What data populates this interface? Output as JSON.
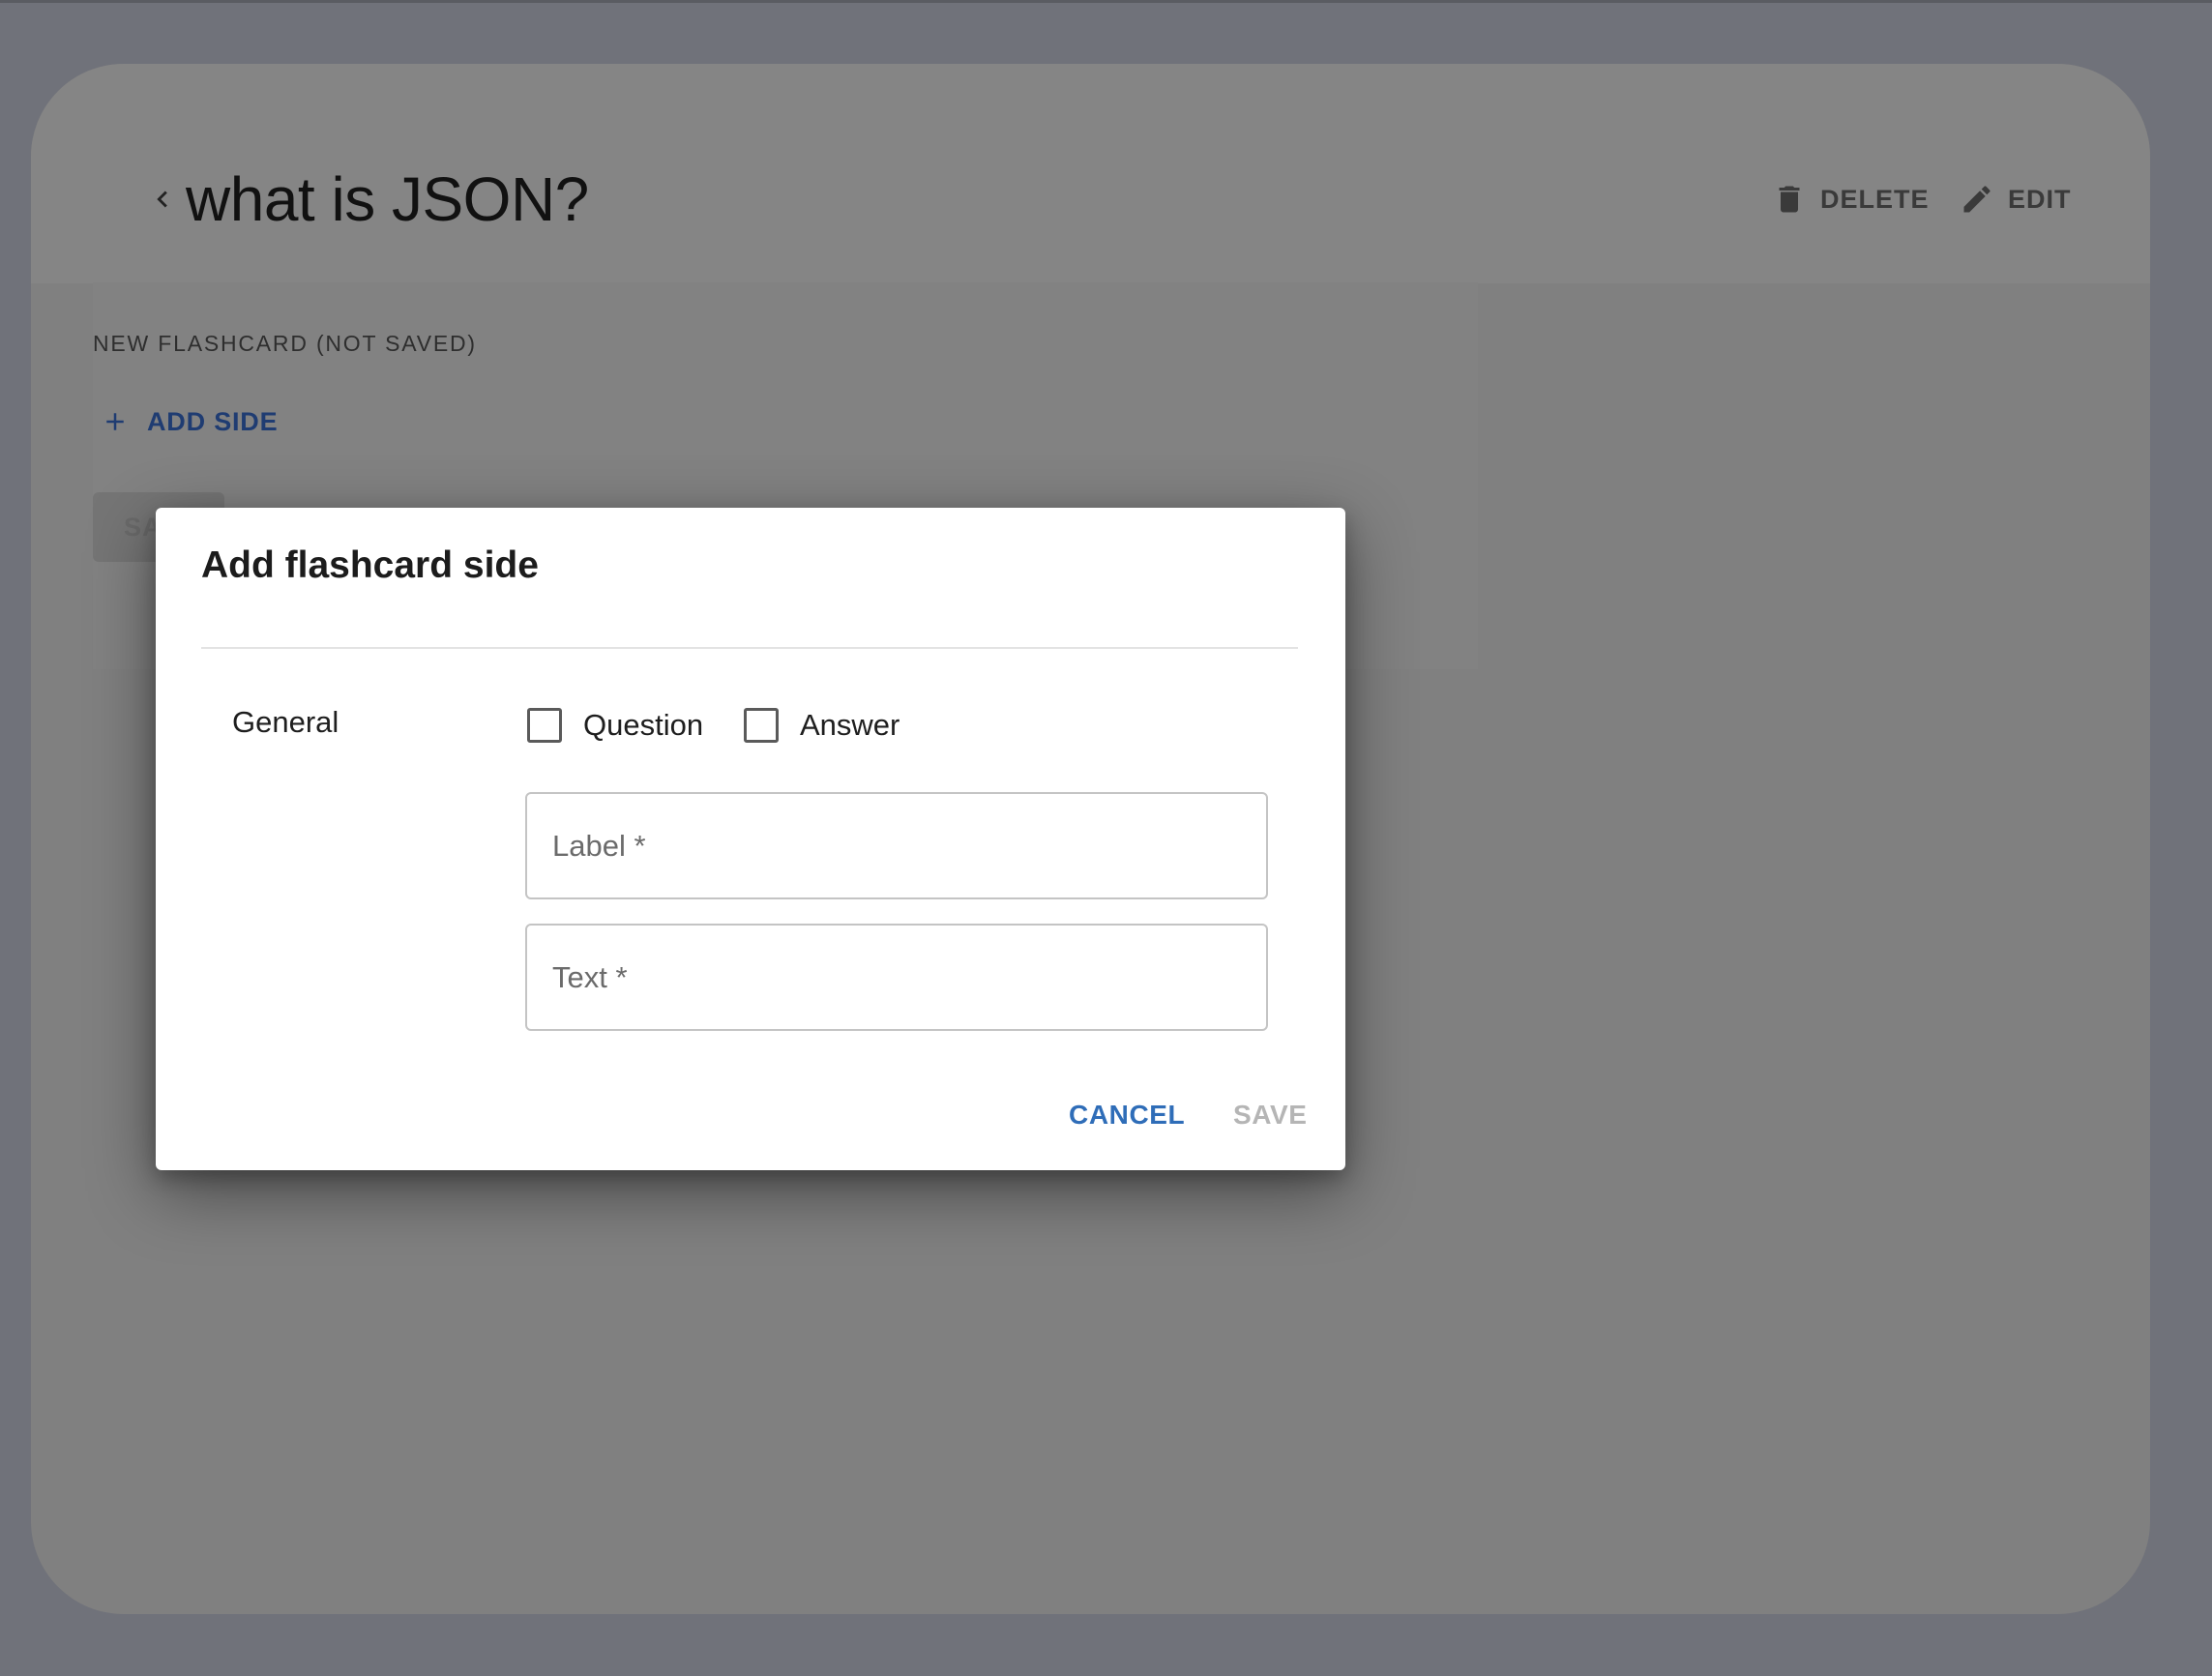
{
  "header": {
    "title": "what is JSON?",
    "delete_label": "DELETE",
    "edit_label": "EDIT"
  },
  "content": {
    "section_label": "NEW FLASHCARD (NOT SAVED)",
    "add_side_label": "ADD SIDE",
    "save_label": "SA"
  },
  "dialog": {
    "title": "Add flashcard side",
    "group_label": "General",
    "checkboxes": [
      {
        "label": "Question",
        "checked": false
      },
      {
        "label": "Answer",
        "checked": false
      }
    ],
    "label_field": {
      "placeholder": "Label *",
      "value": ""
    },
    "text_field": {
      "placeholder": "Text *",
      "value": ""
    },
    "cancel_label": "CANCEL",
    "save_label": "SAVE"
  },
  "icons": {
    "back": "chevron-left-icon",
    "delete": "trash-icon",
    "edit": "pencil-icon",
    "add": "plus-icon"
  },
  "colors": {
    "accent": "#2f6db8",
    "add_side_text": "#1f3c72",
    "disabled": "#b5b5b5",
    "overlay": "#808080"
  }
}
